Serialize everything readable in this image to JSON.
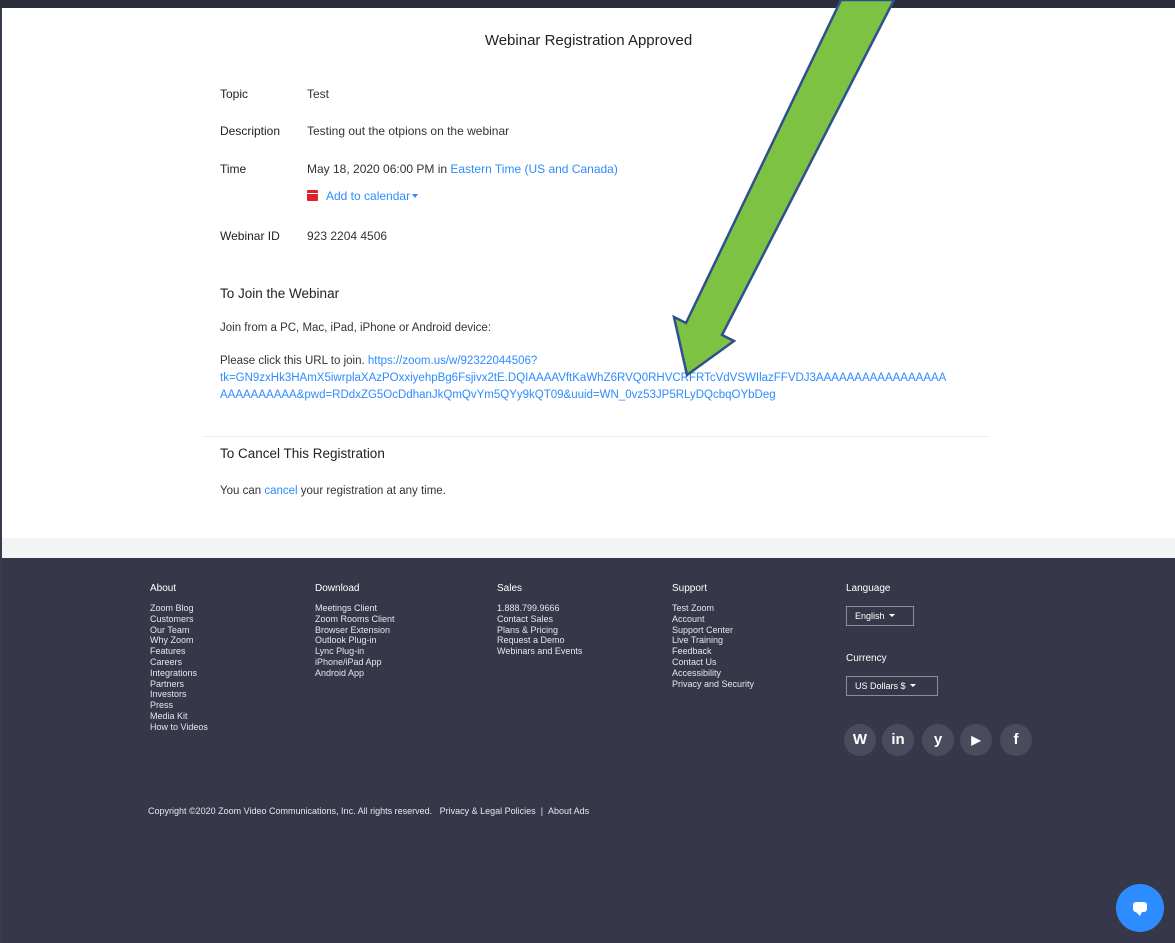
{
  "page": {
    "title": "Webinar Registration Approved"
  },
  "details": {
    "topic_label": "Topic",
    "topic_value": "Test",
    "description_label": "Description",
    "description_value": "Testing out the otpions on the webinar",
    "time_label": "Time",
    "time_value": "May 18, 2020 06:00 PM in ",
    "timezone_link": "Eastern Time (US and Canada)",
    "add_to_calendar": "Add to calendar",
    "webinar_id_label": "Webinar ID",
    "webinar_id_value": "923 2204 4506"
  },
  "join": {
    "heading": "To Join the Webinar",
    "device_text": "Join from a PC, Mac, iPad, iPhone or Android device:",
    "url_prompt": "Please click this URL to join. ",
    "url_line1": "https://zoom.us/w/92322044506?",
    "url_line2": "tk=GN9zxHk3HAmX5iwrplaXAzPOxxiyehpBg6Fsjivx2tE.DQIAAAAVftKaWhZ6RVQ0RHVCRFRTcVdVSWIlazFFVDJ3AAAAAAAAAAAAAAAAA",
    "url_line3": "AAAAAAAAAA&pwd=RDdxZG5OcDdhanJkQmQvYm5QYy9kQT09&uuid=WN_0vz53JP5RLyDQcbqOYbDeg"
  },
  "cancel": {
    "heading": "To Cancel This Registration",
    "text_before": "You can ",
    "link": "cancel",
    "text_after": " your registration at any time."
  },
  "footer": {
    "about": {
      "heading": "About",
      "items": [
        "Zoom Blog",
        "Customers",
        "Our Team",
        "Why Zoom",
        "Features",
        "Careers",
        "Integrations",
        "Partners",
        "Investors",
        "Press",
        "Media Kit",
        "How to Videos"
      ]
    },
    "download": {
      "heading": "Download",
      "items": [
        "Meetings Client",
        "Zoom Rooms Client",
        "Browser Extension",
        "Outlook Plug-in",
        "Lync Plug-in",
        "iPhone/iPad App",
        "Android App"
      ]
    },
    "sales": {
      "heading": "Sales",
      "items": [
        "1.888.799.9666",
        "Contact Sales",
        "Plans & Pricing",
        "Request a Demo",
        "Webinars and Events"
      ]
    },
    "support": {
      "heading": "Support",
      "items": [
        "Test Zoom",
        "Account",
        "Support Center",
        "Live Training",
        "Feedback",
        "Contact Us",
        "Accessibility",
        "Privacy and Security"
      ]
    },
    "language": {
      "heading": "Language",
      "selected": "English"
    },
    "currency": {
      "heading": "Currency",
      "selected": "US Dollars $"
    },
    "social": {
      "wordpress": "W",
      "linkedin": "in",
      "twitter": "y",
      "youtube": "▶",
      "facebook": "f"
    },
    "copyright": "Copyright ©2020 Zoom Video Communications, Inc. All rights reserved.",
    "privacy_link": "Privacy & Legal Policies",
    "separator": "|",
    "about_ads_link": "About Ads"
  },
  "colors": {
    "link": "#2d8cff",
    "footer_bg": "#363849",
    "arrow_fill": "#7dc242",
    "arrow_stroke": "#2f4f8f"
  }
}
